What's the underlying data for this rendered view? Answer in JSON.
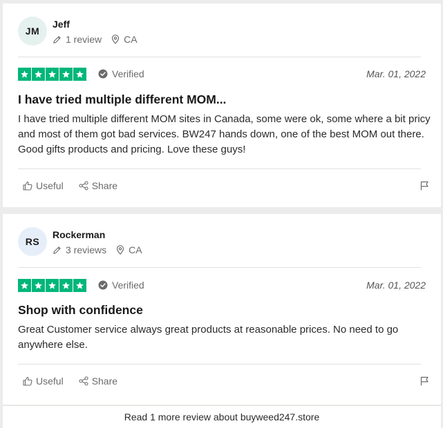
{
  "reviews": [
    {
      "avatar_initials": "JM",
      "name": "Jeff",
      "review_count": "1 review",
      "country": "CA",
      "verified_label": "Verified",
      "date": "Mar. 01, 2022",
      "stars": 5,
      "title": "I have tried multiple different MOM...",
      "body": "I have tried multiple different MOM sites in Canada, some were ok, some where a bit pricy and most of them got bad services. BW247 hands down, one of the best MOM out there. Good gifts products and pricing. Love these guys!",
      "useful_label": "Useful",
      "share_label": "Share"
    },
    {
      "avatar_initials": "RS",
      "name": "Rockerman",
      "review_count": "3 reviews",
      "country": "CA",
      "verified_label": "Verified",
      "date": "Mar. 01, 2022",
      "stars": 5,
      "title": "Shop with confidence",
      "body": "Great Customer service always great products at reasonable prices. No need to go anywhere else.",
      "useful_label": "Useful",
      "share_label": "Share"
    }
  ],
  "footer": {
    "read_more_label": "Read 1 more review about buyweed247.store"
  },
  "colors": {
    "star_green": "#00b67a",
    "avatar_jm_bg": "#e5f1ee",
    "avatar_rs_bg": "#e5eef9",
    "muted_text": "#6b6b6b"
  },
  "icons": [
    "pencil-icon",
    "location-pin-icon",
    "star-icon",
    "verified-check-icon",
    "thumbs-up-icon",
    "share-icon",
    "flag-icon"
  ]
}
